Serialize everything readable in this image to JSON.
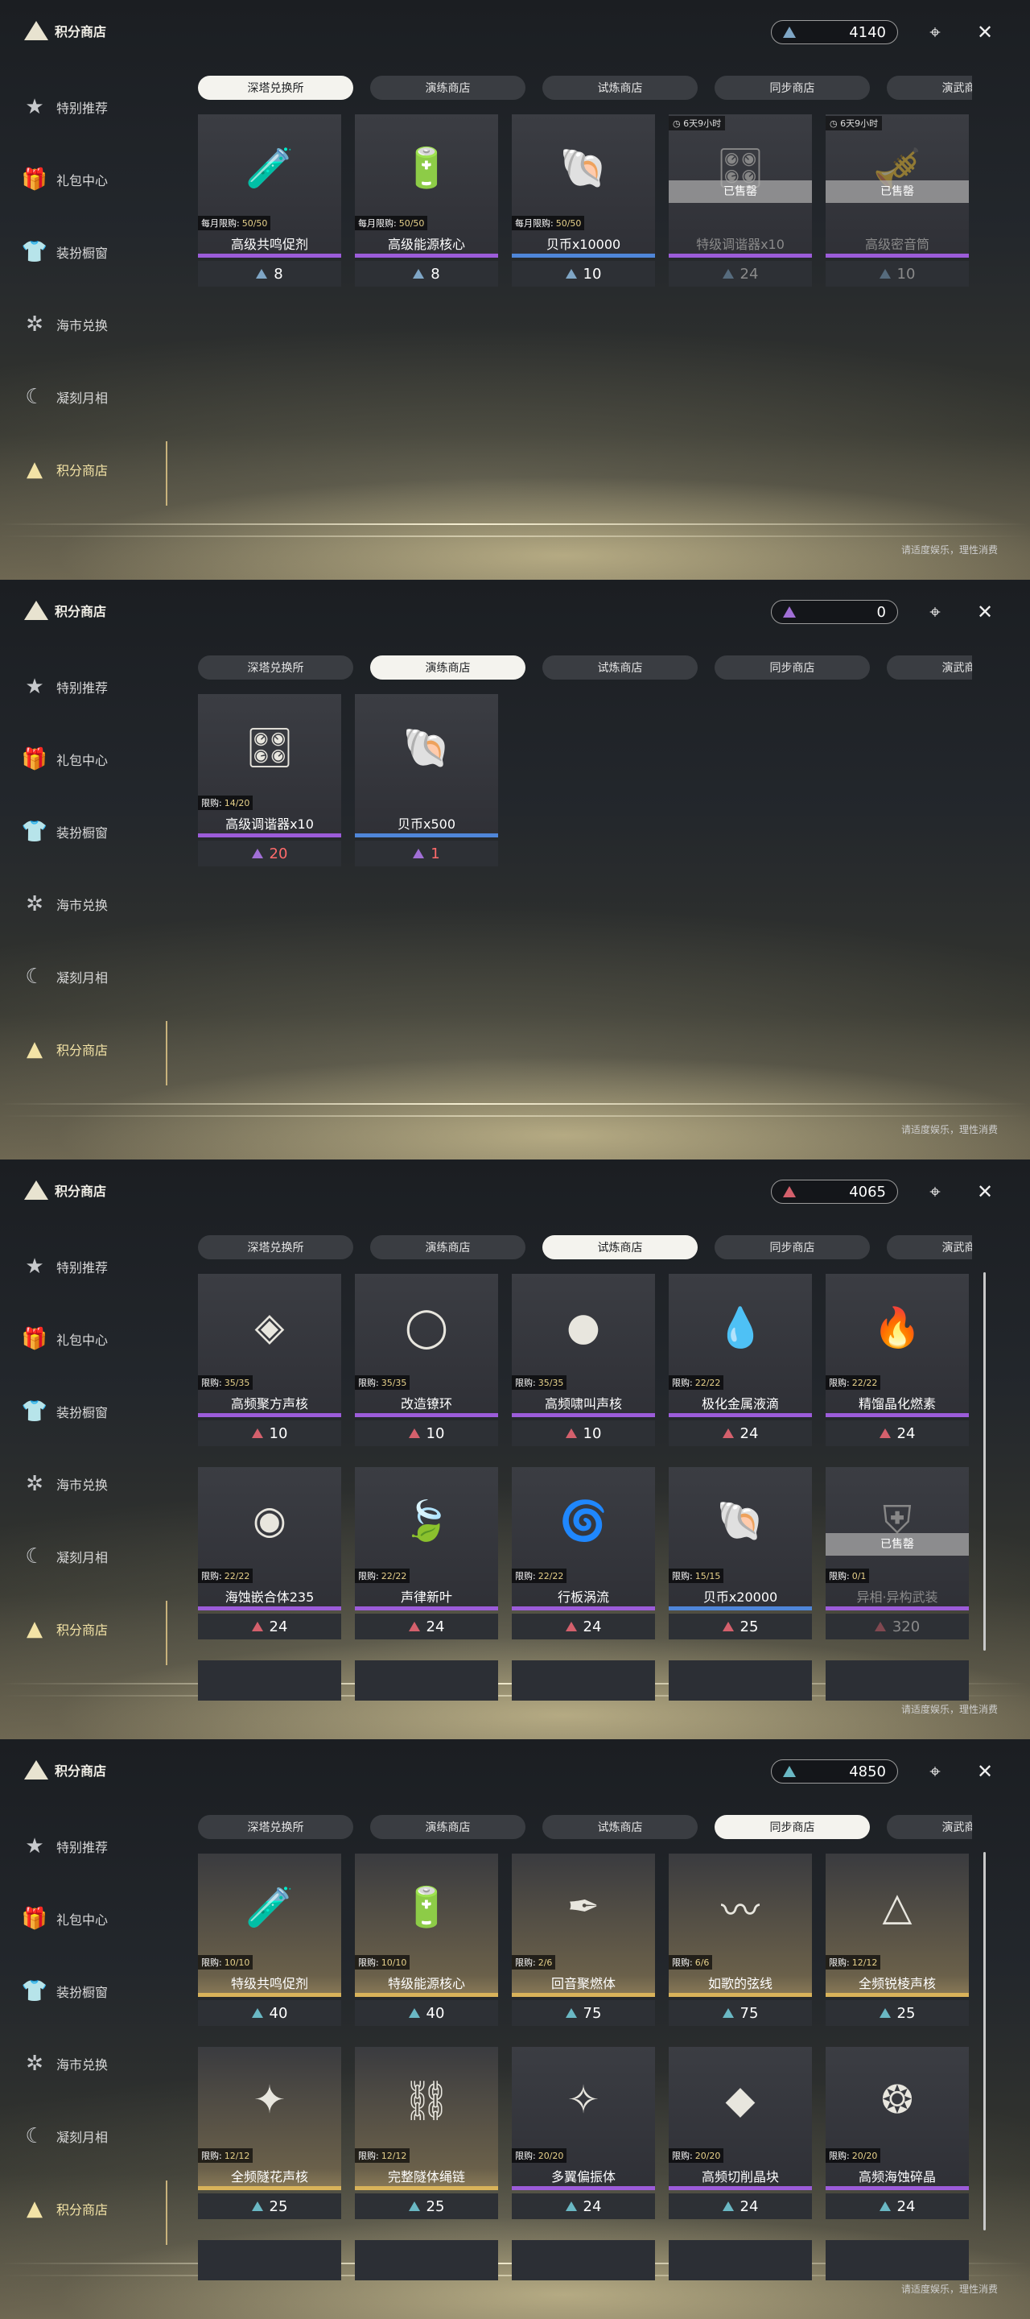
{
  "panels": [
    {
      "title": "积分商店",
      "currency": {
        "amount": "4140",
        "color": "#7fa6c6"
      },
      "sidebar": [
        "特别推荐",
        "礼包中心",
        "装扮橱窗",
        "海市兑换",
        "凝刻月相",
        "积分商店"
      ],
      "tabs": [
        "深塔兑换所",
        "演练商店",
        "试炼商店",
        "同步商店",
        "演武商店"
      ],
      "active_tab": 0,
      "footer": "请适度娱乐，理性消费",
      "items": [
        {
          "name": "高级共鸣促剂",
          "limit_label": "每月限购:",
          "limit": "50/50",
          "price": "8",
          "style": "purple",
          "icon": "vial-icon",
          "sold": false,
          "timer": ""
        },
        {
          "name": "高级能源核心",
          "limit_label": "每月限购:",
          "limit": "50/50",
          "price": "8",
          "style": "purple",
          "icon": "energy-core-icon",
          "sold": false,
          "timer": ""
        },
        {
          "name": "贝币x10000",
          "limit_label": "每月限购:",
          "limit": "50/50",
          "price": "10",
          "style": "blue",
          "icon": "shell-coin-icon",
          "sold": false,
          "timer": ""
        },
        {
          "name": "特级调谐器x10",
          "limit_label": "",
          "limit": "",
          "price": "24",
          "style": "purple",
          "icon": "tuner-icon",
          "sold": true,
          "timer": "6天9小时",
          "sold_label": "已售罄"
        },
        {
          "name": "高级密音筒",
          "limit_label": "",
          "limit": "",
          "price": "10",
          "style": "purple",
          "icon": "sound-tube-icon",
          "sold": true,
          "timer": "6天9小时",
          "sold_label": "已售罄"
        }
      ]
    },
    {
      "title": "积分商店",
      "currency": {
        "amount": "0",
        "color": "#a16fd6"
      },
      "sidebar": [
        "特别推荐",
        "礼包中心",
        "装扮橱窗",
        "海市兑换",
        "凝刻月相",
        "积分商店"
      ],
      "tabs": [
        "深塔兑换所",
        "演练商店",
        "试炼商店",
        "同步商店",
        "演武商店"
      ],
      "active_tab": 1,
      "footer": "请适度娱乐，理性消费",
      "items": [
        {
          "name": "高级调谐器x10",
          "limit_label": "限购:",
          "limit": "14/20",
          "price": "20",
          "style": "purple",
          "icon": "tuner-icon",
          "sold": false,
          "timer": "",
          "price_red": true
        },
        {
          "name": "贝币x500",
          "limit_label": "",
          "limit": "",
          "price": "1",
          "style": "blue",
          "icon": "shell-coin-icon",
          "sold": false,
          "timer": "",
          "price_red": true
        }
      ]
    },
    {
      "title": "积分商店",
      "currency": {
        "amount": "4065",
        "color": "#d4606c"
      },
      "sidebar": [
        "特别推荐",
        "礼包中心",
        "装扮橱窗",
        "海市兑换",
        "凝刻月相",
        "积分商店"
      ],
      "tabs": [
        "深塔兑换所",
        "演练商店",
        "试炼商店",
        "同步商店",
        "演武商店"
      ],
      "active_tab": 2,
      "footer": "请适度娱乐，理性消费",
      "items": [
        {
          "name": "高频聚方声核",
          "limit_label": "限购:",
          "limit": "35/35",
          "price": "10",
          "style": "purple",
          "icon": "echo-core-icon"
        },
        {
          "name": "改造镣环",
          "limit_label": "限购:",
          "limit": "35/35",
          "price": "10",
          "style": "purple",
          "icon": "ring-icon"
        },
        {
          "name": "高频啸叫声核",
          "limit_label": "限购:",
          "limit": "35/35",
          "price": "10",
          "style": "purple",
          "icon": "orb-icon"
        },
        {
          "name": "极化金属液滴",
          "limit_label": "限购:",
          "limit": "22/22",
          "price": "24",
          "style": "purple",
          "icon": "droplet-icon"
        },
        {
          "name": "精馏晶化燃素",
          "limit_label": "限购:",
          "limit": "22/22",
          "price": "24",
          "style": "purple",
          "icon": "flame-icon"
        },
        {
          "name": "海蚀嵌合体235",
          "limit_label": "限购:",
          "limit": "22/22",
          "price": "24",
          "style": "purple",
          "icon": "chimera-icon"
        },
        {
          "name": "声律新叶",
          "limit_label": "限购:",
          "limit": "22/22",
          "price": "24",
          "style": "purple",
          "icon": "leaf-icon"
        },
        {
          "name": "行板涡流",
          "limit_label": "限购:",
          "limit": "22/22",
          "price": "24",
          "style": "purple",
          "icon": "vortex-icon"
        },
        {
          "name": "贝币x20000",
          "limit_label": "限购:",
          "limit": "15/15",
          "price": "25",
          "style": "blue",
          "icon": "shell-coin-icon"
        },
        {
          "name": "异相·异构武装",
          "limit_label": "限购:",
          "limit": "0/1",
          "price": "320",
          "style": "purple",
          "icon": "armor-icon",
          "sold": true,
          "sold_label": "已售罄"
        }
      ]
    },
    {
      "title": "积分商店",
      "currency": {
        "amount": "4850",
        "color": "#6ab8c4"
      },
      "sidebar": [
        "特别推荐",
        "礼包中心",
        "装扮橱窗",
        "海市兑换",
        "凝刻月相",
        "积分商店"
      ],
      "tabs": [
        "深塔兑换所",
        "演练商店",
        "试炼商店",
        "同步商店",
        "演武商店"
      ],
      "active_tab": 3,
      "footer": "请适度娱乐，理性消费",
      "items": [
        {
          "name": "特级共鸣促剂",
          "limit_label": "限购:",
          "limit": "10/10",
          "price": "40",
          "style": "gold",
          "icon": "vial-icon"
        },
        {
          "name": "特级能源核心",
          "limit_label": "限购:",
          "limit": "10/10",
          "price": "40",
          "style": "gold",
          "icon": "energy-core-icon"
        },
        {
          "name": "回音聚燃体",
          "limit_label": "限购:",
          "limit": "2/6",
          "price": "75",
          "style": "gold",
          "icon": "feather-icon"
        },
        {
          "name": "如歌的弦线",
          "limit_label": "限购:",
          "limit": "6/6",
          "price": "75",
          "style": "gold",
          "icon": "string-icon"
        },
        {
          "name": "全频锐棱声核",
          "limit_label": "限购:",
          "limit": "12/12",
          "price": "25",
          "style": "gold",
          "icon": "prism-icon"
        },
        {
          "name": "全频隧花声核",
          "limit_label": "限购:",
          "limit": "12/12",
          "price": "25",
          "style": "gold",
          "icon": "star-flower-icon"
        },
        {
          "name": "完整隧体绳链",
          "limit_label": "限购:",
          "limit": "12/12",
          "price": "25",
          "style": "gold",
          "icon": "chain-icon"
        },
        {
          "name": "多翼偏振体",
          "limit_label": "限购:",
          "limit": "20/20",
          "price": "24",
          "style": "purple",
          "icon": "wing-icon"
        },
        {
          "name": "高频切削晶块",
          "limit_label": "限购:",
          "limit": "20/20",
          "price": "24",
          "style": "purple",
          "icon": "cube-icon"
        },
        {
          "name": "高频海蚀碎晶",
          "limit_label": "限购:",
          "limit": "20/20",
          "price": "24",
          "style": "purple",
          "icon": "crystal-icon"
        }
      ]
    }
  ]
}
